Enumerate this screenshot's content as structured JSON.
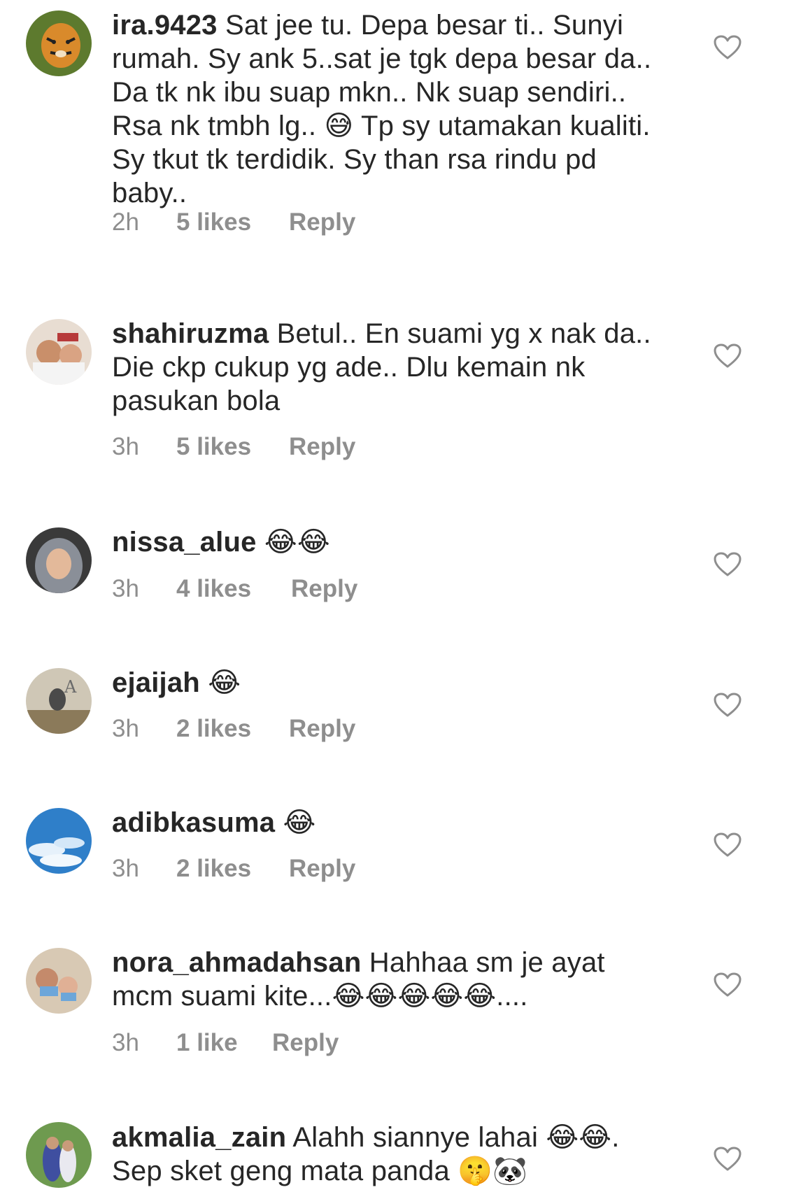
{
  "comments": [
    {
      "username": "ira.9423",
      "text": " Sat jee tu. Depa besar ti.. Sunyi rumah. Sy ank 5..sat je tgk depa besar da.. Da tk nk ibu suap mkn.. Nk suap sendiri.. Rsa nk tmbh lg.. ",
      "emoji1": "😅",
      "text2": " Tp sy utamakan kualiti. Sy tkut tk terdidik. Sy than rsa rindu pd baby..",
      "time": "2h",
      "likes": "5 likes",
      "reply": "Reply",
      "avatar_icon": "tiger-avatar",
      "heart_icon": "heart-outline-icon"
    },
    {
      "username": "shahiruzma",
      "text": " Betul.. En suami yg x nak da.. Die ckp cukup yg ade.. Dlu kemain nk pasukan bola",
      "time": "3h",
      "likes": "5 likes",
      "reply": "Reply",
      "avatar_icon": "family-photo-avatar",
      "heart_icon": "heart-outline-icon"
    },
    {
      "username": "nissa_alue",
      "text": " ",
      "emoji1": "😂😂",
      "time": "3h",
      "likes": "4 likes",
      "reply": "Reply",
      "avatar_icon": "hijab-portrait-avatar",
      "heart_icon": "heart-outline-icon"
    },
    {
      "username": "ejaijah",
      "text": " ",
      "emoji1": "😂",
      "time": "3h",
      "likes": "2 likes",
      "reply": "Reply",
      "avatar_icon": "cafe-photo-avatar",
      "heart_icon": "heart-outline-icon"
    },
    {
      "username": "adibkasuma",
      "text": " ",
      "emoji1": "😂",
      "time": "3h",
      "likes": "2 likes",
      "reply": "Reply",
      "avatar_icon": "sky-clouds-avatar",
      "heart_icon": "heart-outline-icon"
    },
    {
      "username": "nora_ahmadahsan",
      "text": " Hahhaa sm je ayat mcm suami kite...",
      "emoji1": "😂😂😂😂😂",
      "text2": "....",
      "time": "3h",
      "likes": "1 like",
      "reply": "Reply",
      "avatar_icon": "group-photo-avatar",
      "heart_icon": "heart-outline-icon"
    },
    {
      "username": "akmalia_zain",
      "text": " Alahh siannye lahai ",
      "emoji1": "😂😂",
      "text2": ". Sep sket geng mata panda ",
      "emoji2": "🤫🐼",
      "avatar_icon": "garden-couple-avatar",
      "heart_icon": "heart-outline-icon"
    }
  ],
  "colors": {
    "text": "#262626",
    "meta": "#8e8e8e",
    "heart": "#8e8e8e",
    "background": "#ffffff"
  }
}
